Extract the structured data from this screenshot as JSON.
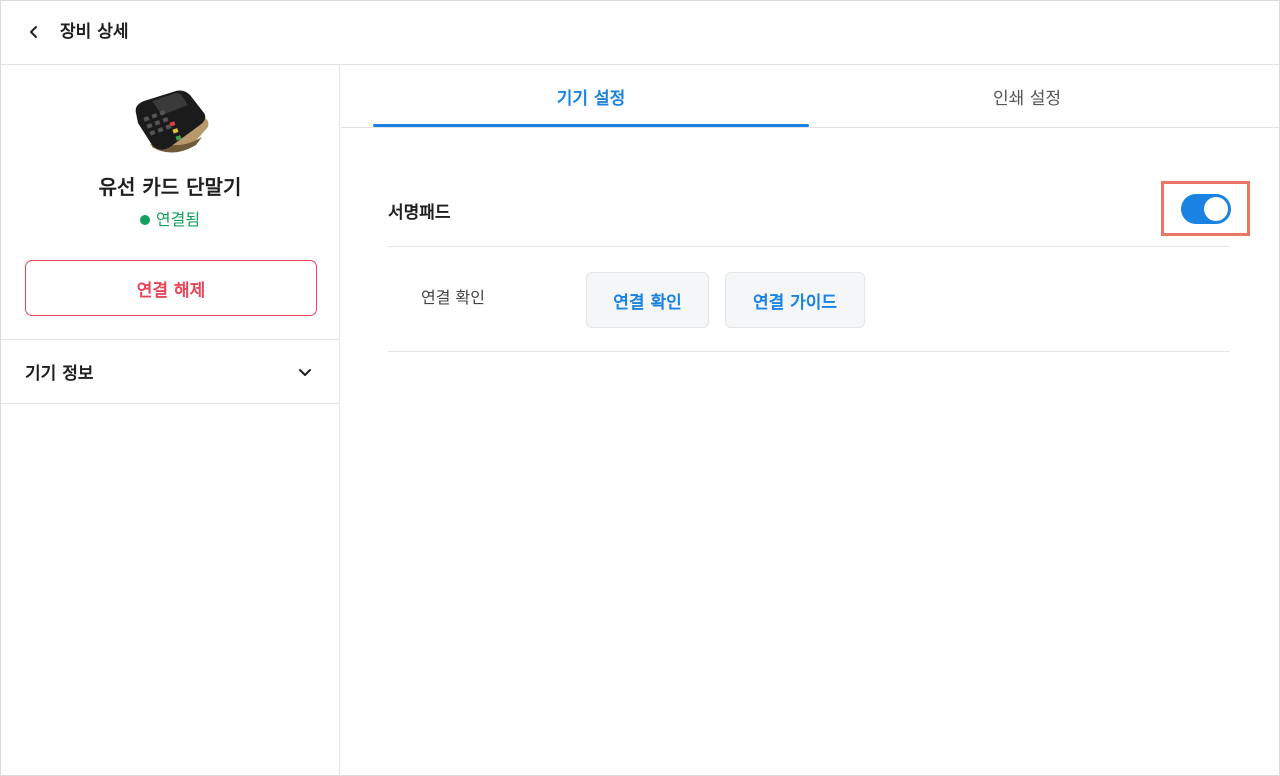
{
  "header": {
    "title": "장비 상세"
  },
  "sidebar": {
    "device_name": "유선 카드 단말기",
    "status": "연결됨",
    "disconnect_label": "연결 해제",
    "device_info_label": "기기 정보"
  },
  "tabs": [
    {
      "label": "기기 설정",
      "active": true
    },
    {
      "label": "인쇄 설정",
      "active": false
    }
  ],
  "settings": {
    "signature_pad_label": "서명패드",
    "signature_pad_enabled": true,
    "connection_label": "연결 확인",
    "check_button_label": "연결 확인",
    "guide_button_label": "연결 가이드"
  },
  "colors": {
    "accent": "#1a82e2",
    "danger": "#e8475a",
    "success": "#12a05c",
    "highlight": "#ea7766"
  }
}
